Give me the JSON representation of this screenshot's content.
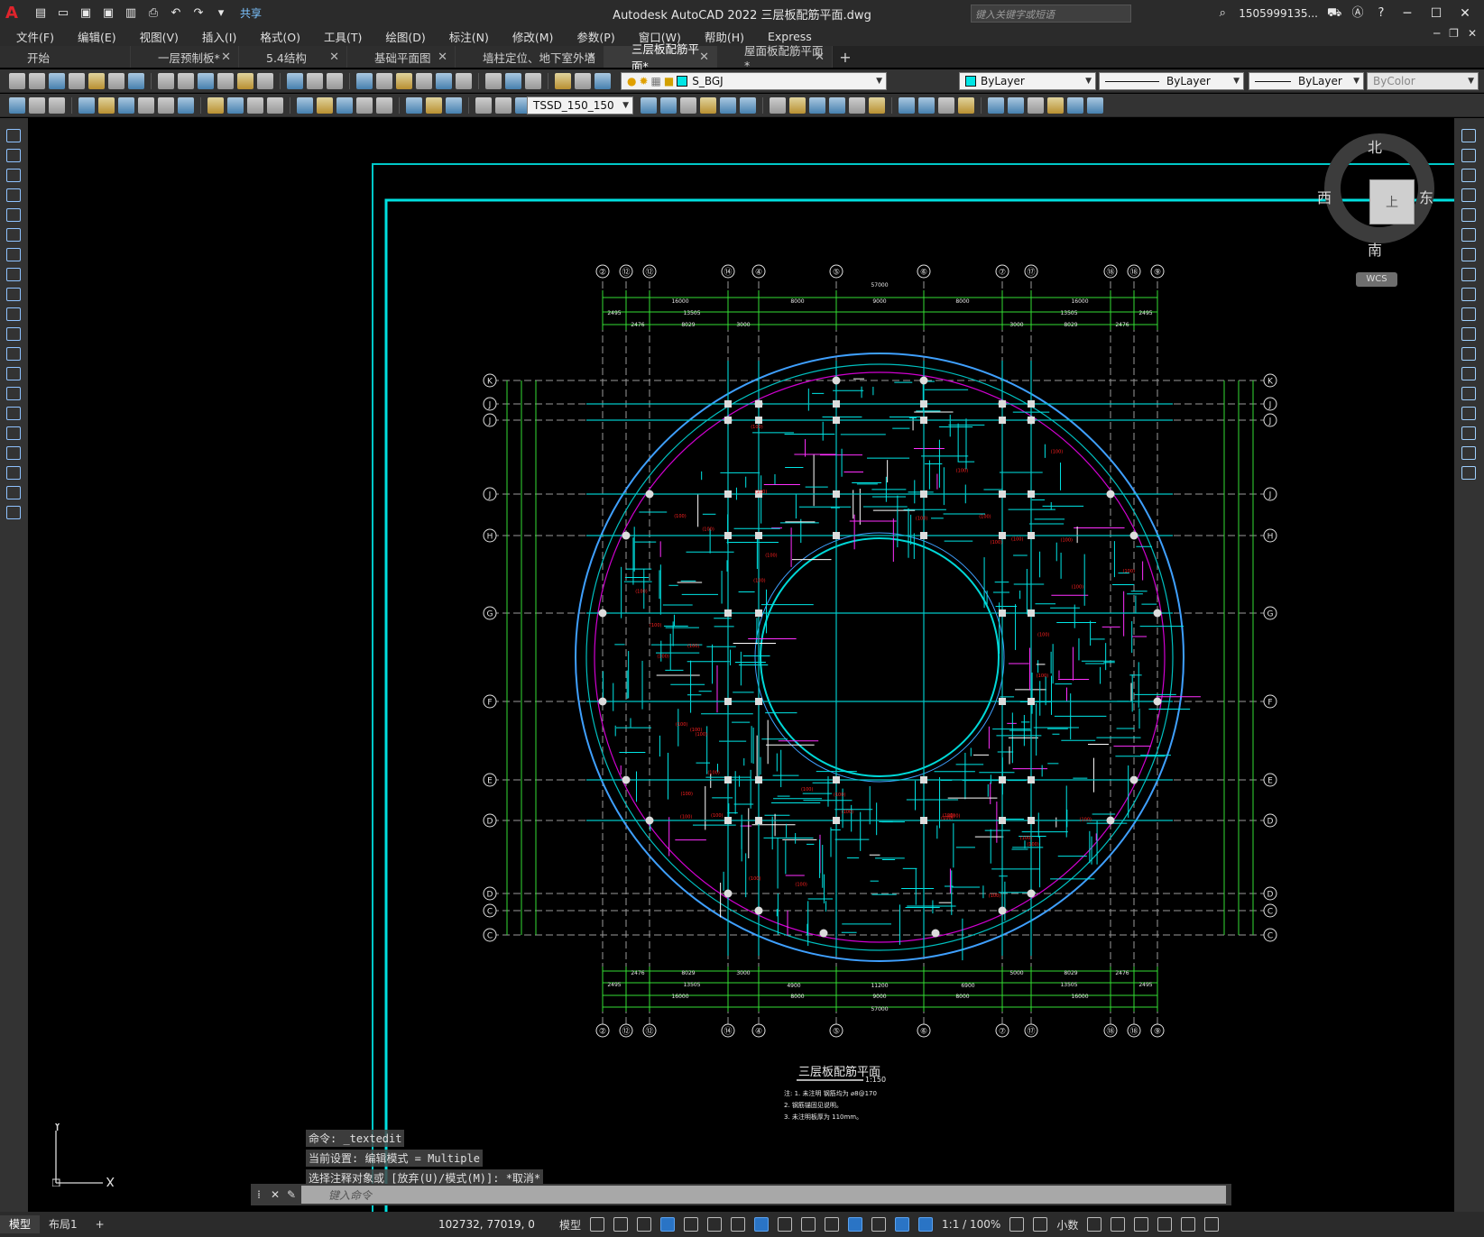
{
  "app": {
    "title": "Autodesk AutoCAD 2022    三层板配筋平面.dwg",
    "search_placeholder": "键入关键字或短语",
    "user": "1505999135...",
    "share": "共享"
  },
  "menu": [
    "文件(F)",
    "编辑(E)",
    "视图(V)",
    "插入(I)",
    "格式(O)",
    "工具(T)",
    "绘图(D)",
    "标注(N)",
    "修改(M)",
    "参数(P)",
    "窗口(W)",
    "帮助(H)",
    "Express"
  ],
  "tabs": [
    {
      "label": "开始",
      "closable": false,
      "active": false
    },
    {
      "label": "一层预制板*",
      "closable": true,
      "active": false
    },
    {
      "label": "5.4结构",
      "closable": true,
      "active": false
    },
    {
      "label": "基础平面图",
      "closable": true,
      "active": false
    },
    {
      "label": "墙柱定位、地下室外墙",
      "closable": true,
      "active": false
    },
    {
      "label": "三层板配筋平面*",
      "closable": true,
      "active": true
    },
    {
      "label": "屋面板配筋平面*",
      "closable": true,
      "active": false
    }
  ],
  "toolbar": {
    "layer": "S_BGJ",
    "color": "ByLayer",
    "linetype": "ByLayer",
    "lineweight": "ByLayer",
    "plotstyle": "ByColor",
    "textstyle": "TSSD_150_150"
  },
  "viewcube": {
    "north": "北",
    "south": "南",
    "east": "东",
    "west": "西",
    "face": "上",
    "wcs": "WCS"
  },
  "command": {
    "history": [
      "命令: _textedit",
      "当前设置: 编辑模式 = Multiple",
      "选择注释对象或 [放弃(U)/模式(M)]: *取消*"
    ],
    "placeholder": "键入命令"
  },
  "drawing": {
    "title": "三层板配筋平面",
    "scale": "1:150",
    "notes": [
      "注: 1. 未注明 钢筋均为 ⌀8@170",
      "2. 钢筋锚固见说明。",
      "3. 未注明板厚为 110mm。"
    ],
    "top_axes": [
      "②",
      "②",
      "②",
      "⑪",
      "④",
      "⑤",
      "⑥",
      "⑦",
      "⑪",
      "⑬",
      "⑬",
      "⑨"
    ],
    "bottom_axes": [
      "②",
      "②",
      "②",
      "⑪",
      "④",
      "⑤",
      "⑥",
      "⑦",
      "⑪",
      "⑬",
      "⑬",
      "⑨"
    ],
    "row_axes": [
      "K",
      "J",
      "J",
      "J",
      "H",
      "G",
      "F",
      "E",
      "D",
      "D",
      "C",
      "C"
    ],
    "dims_top1": [
      "57000"
    ],
    "dims_top2": [
      "16000",
      "8000",
      "9000",
      "8000",
      "16000"
    ],
    "dims_top3": [
      "2495",
      "13505",
      "13505",
      "2495"
    ],
    "dims_top4": [
      "2476",
      "8029",
      "3000",
      "3000",
      "8029",
      "2476"
    ]
  },
  "status": {
    "tabs": [
      "模型",
      "布局1"
    ],
    "coords": "102732, 77019, 0",
    "mode": "模型",
    "scale": "1:1 / 100%",
    "units": "小数"
  }
}
